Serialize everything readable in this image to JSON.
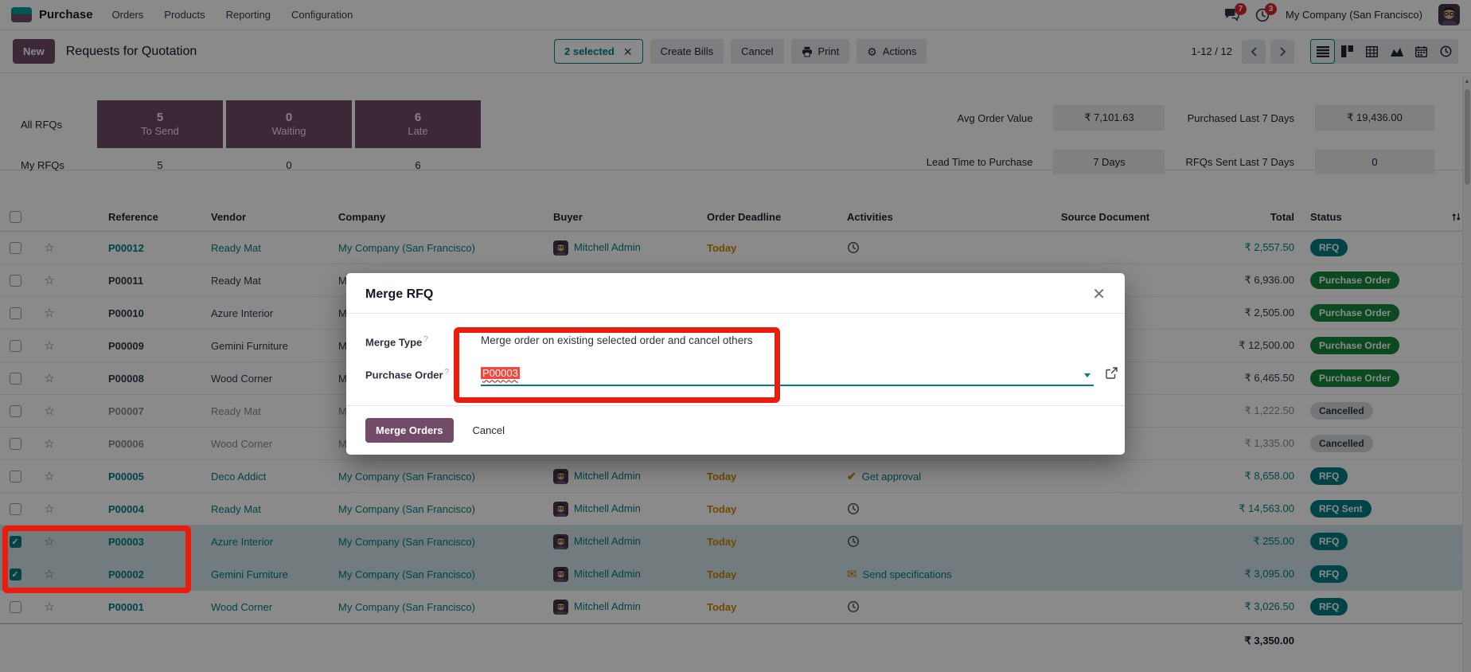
{
  "nav": {
    "app_name": "Purchase",
    "menus": [
      "Orders",
      "Products",
      "Reporting",
      "Configuration"
    ],
    "message_count": "7",
    "activity_count": "3",
    "company": "My Company (San Francisco)"
  },
  "control": {
    "new_label": "New",
    "title": "Requests for Quotation",
    "selected_chip": "2 selected",
    "create_bills": "Create Bills",
    "cancel": "Cancel",
    "print": "Print",
    "actions": "Actions",
    "pager": "1-12 / 12"
  },
  "dashboard": {
    "row1_label": "All RFQs",
    "row2_label": "My RFQs",
    "filters": [
      {
        "value": "5",
        "label": "To Send"
      },
      {
        "value": "0",
        "label": "Waiting"
      },
      {
        "value": "6",
        "label": "Late"
      }
    ],
    "my_values": [
      "5",
      "0",
      "6"
    ],
    "kpis": [
      {
        "label": "Avg Order Value",
        "value": "₹ 7,101.63"
      },
      {
        "label": "Purchased Last 7 Days",
        "value": "₹ 19,436.00"
      },
      {
        "label": "Lead Time to Purchase",
        "value": "7 Days"
      },
      {
        "label": "RFQs Sent Last 7 Days",
        "value": "0"
      }
    ]
  },
  "table": {
    "headers": [
      "Reference",
      "Vendor",
      "Company",
      "Buyer",
      "Order Deadline",
      "Activities",
      "Source Document",
      "Total",
      "Status"
    ],
    "rows": [
      {
        "reference": "P00012",
        "vendor": "Ready Mat",
        "company": "My Company (San Francisco)",
        "buyer": "Mitchell Admin",
        "deadline": "Today",
        "activity": {
          "type": "clock",
          "label": ""
        },
        "source": "",
        "total": "₹ 2,557.50",
        "status": {
          "label": "RFQ",
          "kind": "info"
        },
        "state": "info",
        "checked": false,
        "highlighted": false
      },
      {
        "reference": "P00011",
        "vendor": "Ready Mat",
        "company": "My Company (San Francisco)",
        "buyer": "",
        "deadline": "",
        "activity": {
          "type": "",
          "label": ""
        },
        "source": "",
        "total": "₹ 6,936.00",
        "status": {
          "label": "Purchase Order",
          "kind": "success"
        },
        "state": "normal",
        "checked": false,
        "highlighted": false
      },
      {
        "reference": "P00010",
        "vendor": "Azure Interior",
        "company": "My Company (San Francisco)",
        "buyer": "",
        "deadline": "",
        "activity": {
          "type": "",
          "label": ""
        },
        "source": "",
        "total": "₹ 2,505.00",
        "status": {
          "label": "Purchase Order",
          "kind": "success"
        },
        "state": "normal",
        "checked": false,
        "highlighted": false
      },
      {
        "reference": "P00009",
        "vendor": "Gemini Furniture",
        "company": "My Company (San Francisco)",
        "buyer": "",
        "deadline": "",
        "activity": {
          "type": "",
          "label": ""
        },
        "source": "",
        "total": "₹ 12,500.00",
        "status": {
          "label": "Purchase Order",
          "kind": "success"
        },
        "state": "normal",
        "checked": false,
        "highlighted": false
      },
      {
        "reference": "P00008",
        "vendor": "Wood Corner",
        "company": "My Company (San Francisco)",
        "buyer": "",
        "deadline": "",
        "activity": {
          "type": "",
          "label": ""
        },
        "source": "",
        "total": "₹ 6,465.50",
        "status": {
          "label": "Purchase Order",
          "kind": "success"
        },
        "state": "normal",
        "checked": false,
        "highlighted": false
      },
      {
        "reference": "P00007",
        "vendor": "Ready Mat",
        "company": "My Company (San Francisco)",
        "buyer": "",
        "deadline": "",
        "activity": {
          "type": "",
          "label": ""
        },
        "source": "",
        "total": "₹ 1,222.50",
        "status": {
          "label": "Cancelled",
          "kind": "muted"
        },
        "state": "muted",
        "checked": false,
        "highlighted": false
      },
      {
        "reference": "P00006",
        "vendor": "Wood Corner",
        "company": "My Company (San Francisco)",
        "buyer": "",
        "deadline": "",
        "activity": {
          "type": "",
          "label": ""
        },
        "source": "",
        "total": "₹ 1,335.00",
        "status": {
          "label": "Cancelled",
          "kind": "muted"
        },
        "state": "muted",
        "checked": false,
        "highlighted": false
      },
      {
        "reference": "P00005",
        "vendor": "Deco Addict",
        "company": "My Company (San Francisco)",
        "buyer": "Mitchell Admin",
        "deadline": "Today",
        "activity": {
          "type": "check",
          "label": "Get approval"
        },
        "source": "",
        "total": "₹ 8,658.00",
        "status": {
          "label": "RFQ",
          "kind": "info"
        },
        "state": "info",
        "checked": false,
        "highlighted": false
      },
      {
        "reference": "P00004",
        "vendor": "Ready Mat",
        "company": "My Company (San Francisco)",
        "buyer": "Mitchell Admin",
        "deadline": "Today",
        "activity": {
          "type": "clock",
          "label": ""
        },
        "source": "",
        "total": "₹ 14,563.00",
        "status": {
          "label": "RFQ Sent",
          "kind": "info"
        },
        "state": "info",
        "checked": false,
        "highlighted": false
      },
      {
        "reference": "P00003",
        "vendor": "Azure Interior",
        "company": "My Company (San Francisco)",
        "buyer": "Mitchell Admin",
        "deadline": "Today",
        "activity": {
          "type": "clock",
          "label": ""
        },
        "source": "",
        "total": "₹ 255.00",
        "status": {
          "label": "RFQ",
          "kind": "info"
        },
        "state": "info",
        "checked": true,
        "highlighted": true
      },
      {
        "reference": "P00002",
        "vendor": "Gemini Furniture",
        "company": "My Company (San Francisco)",
        "buyer": "Mitchell Admin",
        "deadline": "Today",
        "activity": {
          "type": "envelope",
          "label": "Send specifications"
        },
        "source": "",
        "total": "₹ 3,095.00",
        "status": {
          "label": "RFQ",
          "kind": "info"
        },
        "state": "info",
        "checked": true,
        "highlighted": true
      },
      {
        "reference": "P00001",
        "vendor": "Wood Corner",
        "company": "My Company (San Francisco)",
        "buyer": "Mitchell Admin",
        "deadline": "Today",
        "activity": {
          "type": "clock",
          "label": ""
        },
        "source": "",
        "total": "₹ 3,026.50",
        "status": {
          "label": "RFQ",
          "kind": "info"
        },
        "state": "info",
        "checked": false,
        "highlighted": false
      }
    ],
    "footer_total": "₹ 3,350.00"
  },
  "modal": {
    "title": "Merge RFQ",
    "merge_type_label": "Merge Type",
    "merge_type_value": "Merge order on existing selected order and cancel others",
    "purchase_order_label": "Purchase Order",
    "purchase_order_value": "P00003",
    "merge_button": "Merge Orders",
    "cancel_button": "Cancel"
  }
}
